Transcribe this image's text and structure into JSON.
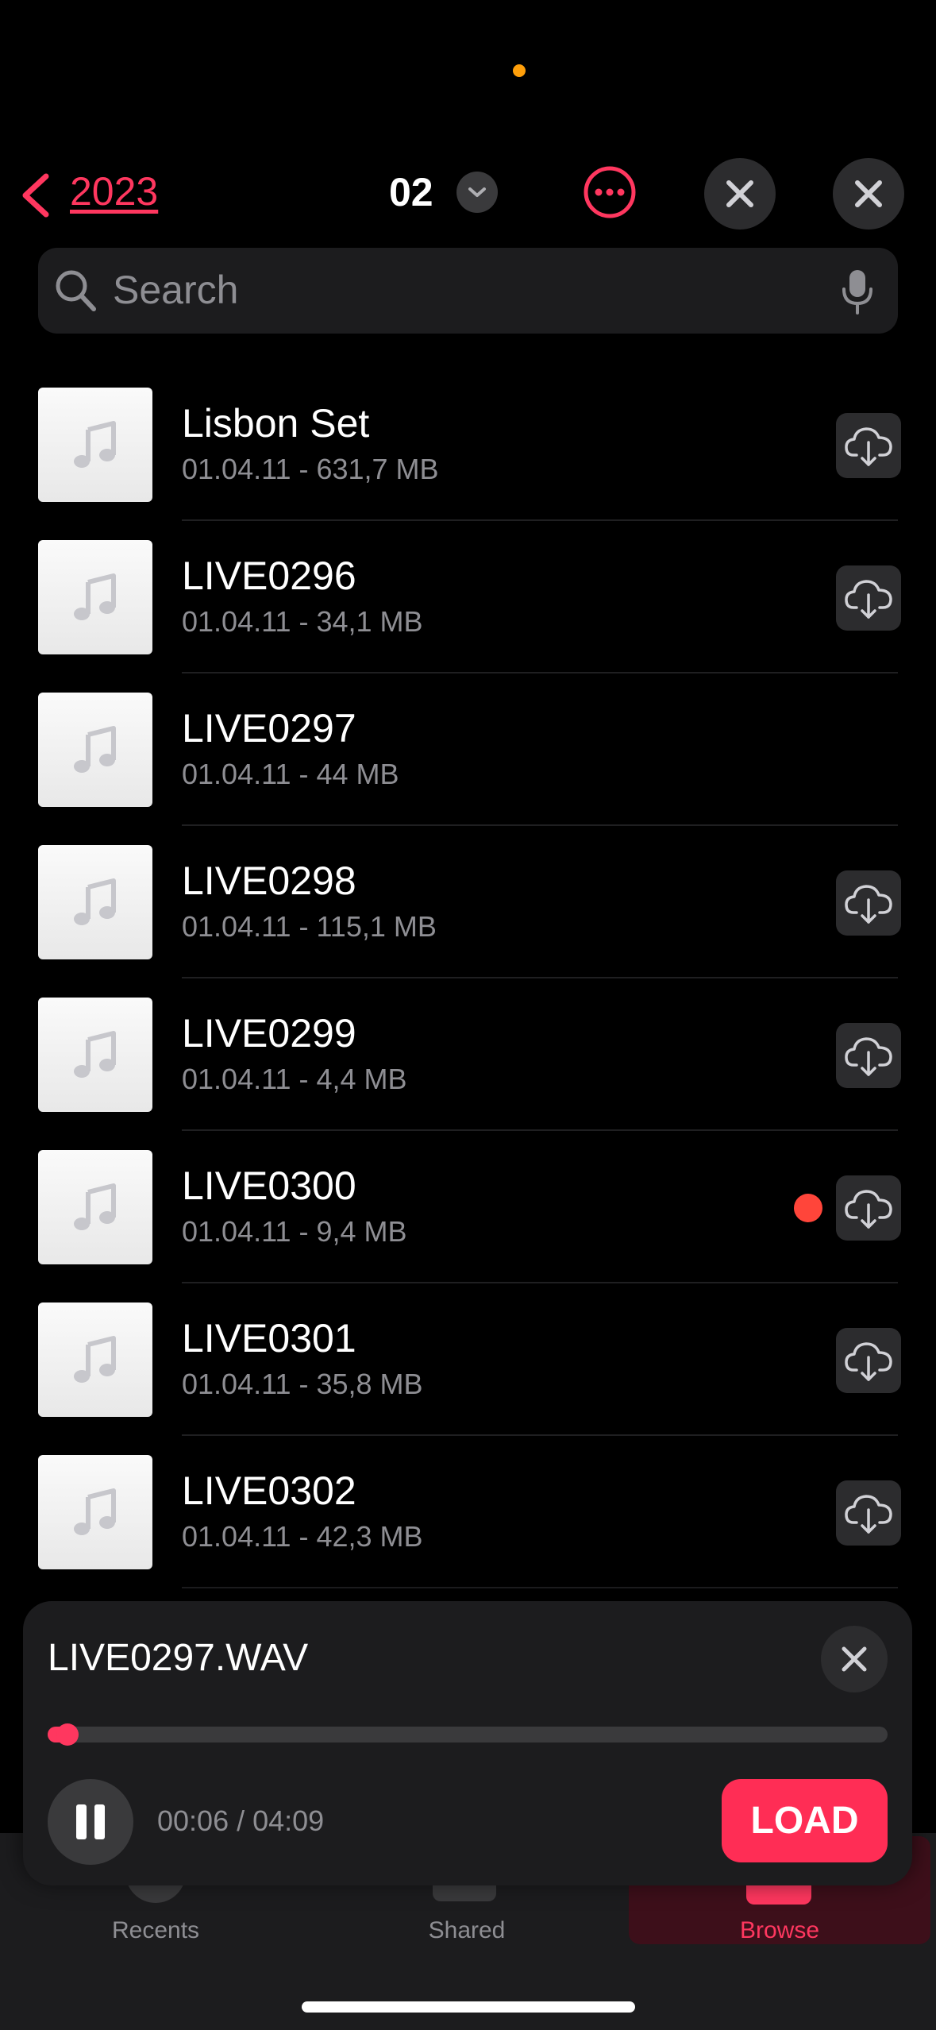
{
  "header": {
    "back_label": "2023",
    "folder_title": "02",
    "more_icon": "ellipsis-circle-icon",
    "accent_color": "#ff375f"
  },
  "search": {
    "placeholder": "Search"
  },
  "files": [
    {
      "title": "Lisbon Set",
      "subtitle": "01.04.11 - 631,7 MB",
      "cloud": true,
      "recording": false
    },
    {
      "title": "LIVE0296",
      "subtitle": "01.04.11 - 34,1 MB",
      "cloud": true,
      "recording": false
    },
    {
      "title": "LIVE0297",
      "subtitle": "01.04.11 - 44 MB",
      "cloud": false,
      "recording": false
    },
    {
      "title": "LIVE0298",
      "subtitle": "01.04.11 - 115,1 MB",
      "cloud": true,
      "recording": false
    },
    {
      "title": "LIVE0299",
      "subtitle": "01.04.11 - 4,4 MB",
      "cloud": true,
      "recording": false
    },
    {
      "title": "LIVE0300",
      "subtitle": "01.04.11 - 9,4 MB",
      "cloud": true,
      "recording": true
    },
    {
      "title": "LIVE0301",
      "subtitle": "01.04.11 - 35,8 MB",
      "cloud": true,
      "recording": false
    },
    {
      "title": "LIVE0302",
      "subtitle": "01.04.11 - 42,3 MB",
      "cloud": true,
      "recording": false
    }
  ],
  "player": {
    "title": "LIVE0297.WAV",
    "time": "00:06 / 04:09",
    "progress": 0.024,
    "load_label": "LOAD"
  },
  "tabs": [
    {
      "label": "Recents",
      "icon": "clock-icon",
      "active": false
    },
    {
      "label": "Shared",
      "icon": "folder-shared-icon",
      "active": false
    },
    {
      "label": "Browse",
      "icon": "folder-icon",
      "active": true
    }
  ]
}
